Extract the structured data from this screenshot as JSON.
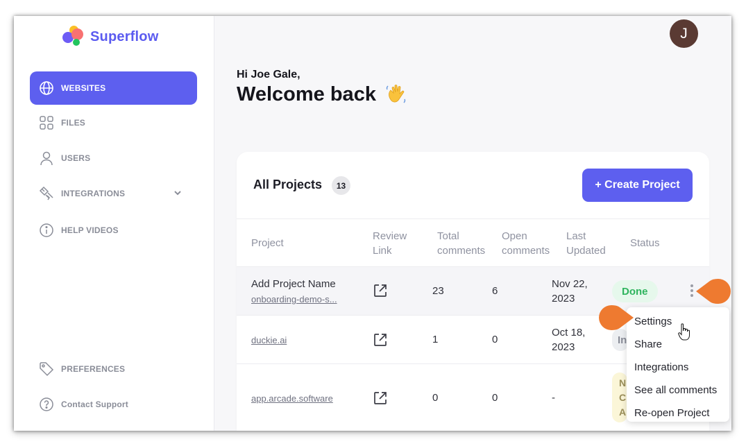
{
  "app": {
    "name": "Superflow"
  },
  "sidebar": {
    "items": [
      {
        "label": "WEBSITES",
        "icon": "globe-icon",
        "active": true
      },
      {
        "label": "FILES",
        "icon": "grid-icon"
      },
      {
        "label": "USERS",
        "icon": "user-icon"
      },
      {
        "label": "INTEGRATIONS",
        "icon": "plug-icon",
        "expandable": true
      },
      {
        "label": "HELP VIDEOS",
        "icon": "info-icon"
      }
    ],
    "bottom_items": [
      {
        "label": "PREFERENCES",
        "icon": "tag-icon"
      },
      {
        "label": "Contact Support",
        "icon": "question-icon"
      }
    ]
  },
  "user": {
    "avatar_initial": "J",
    "greeting": "Hi Joe Gale,",
    "welcome": "Welcome back"
  },
  "projects": {
    "title": "All Projects",
    "count": "13",
    "create_label": "+ Create Project",
    "columns": [
      {
        "line1": "Project",
        "line2": ""
      },
      {
        "line1": "Review",
        "line2": "Link"
      },
      {
        "line1": "Total",
        "line2": "comments"
      },
      {
        "line1": "Open",
        "line2": "comments"
      },
      {
        "line1": "Last",
        "line2": "Updated"
      },
      {
        "line1": "Status",
        "line2": ""
      }
    ],
    "rows": [
      {
        "name": "Add Project Name",
        "link": "onboarding-demo-s...",
        "total": "23",
        "open": "6",
        "updated_1": "Nov 22,",
        "updated_2": "2023",
        "status": "Done"
      },
      {
        "name": "",
        "link": "duckie.ai",
        "total": "1",
        "open": "0",
        "updated_1": "Oct 18,",
        "updated_2": "2023",
        "status": "In"
      },
      {
        "name": "",
        "link": "app.arcade.software",
        "total": "0",
        "open": "0",
        "updated_1": "-",
        "updated_2": "",
        "status_lines": [
          "N",
          "C",
          "A"
        ]
      }
    ]
  },
  "menu": {
    "items": [
      "Settings",
      "Share",
      "Integrations",
      "See all comments",
      "Re-open Project"
    ]
  },
  "colors": {
    "accent": "#5d5fef",
    "pointer": "#ee7a30",
    "done_bg": "#e6f8ec",
    "done_text": "#2fb45e"
  }
}
